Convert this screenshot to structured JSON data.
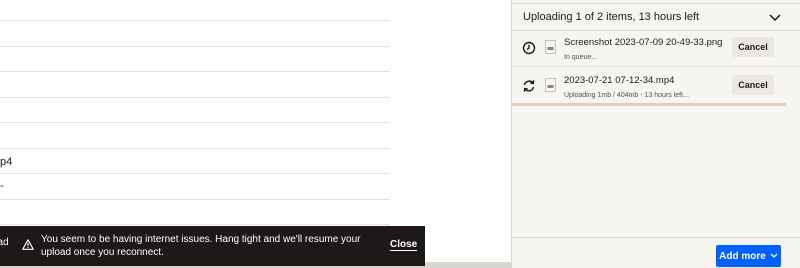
{
  "background_list": {
    "row_fragments": [
      "p4",
      "-",
      "pad"
    ]
  },
  "upload_panel": {
    "title": "Uploading 1 of 2 items, 13 hours left",
    "items": [
      {
        "file_name": "Screenshot 2023-07-09 20-49-33.png",
        "status": "In queue...",
        "status_icon": "clock-icon",
        "cancel_label": "Cancel"
      },
      {
        "file_name": "2023-07-21 07-12-34.mp4",
        "status": "Uploading 1mb / 404mb - 13 hours left...",
        "status_icon": "sync-icon",
        "cancel_label": "Cancel",
        "progress_fraction": 0.95
      }
    ],
    "add_more_label": "Add more"
  },
  "toast": {
    "message": "You seem to be having internet issues. Hang tight and we'll resume your upload once you reconnect.",
    "close_label": "Close"
  },
  "colors": {
    "accent": "#0061fe",
    "toast_bg": "#1e1919",
    "panel_bg": "#f7f5f2",
    "progress": "#e0cfbd"
  }
}
